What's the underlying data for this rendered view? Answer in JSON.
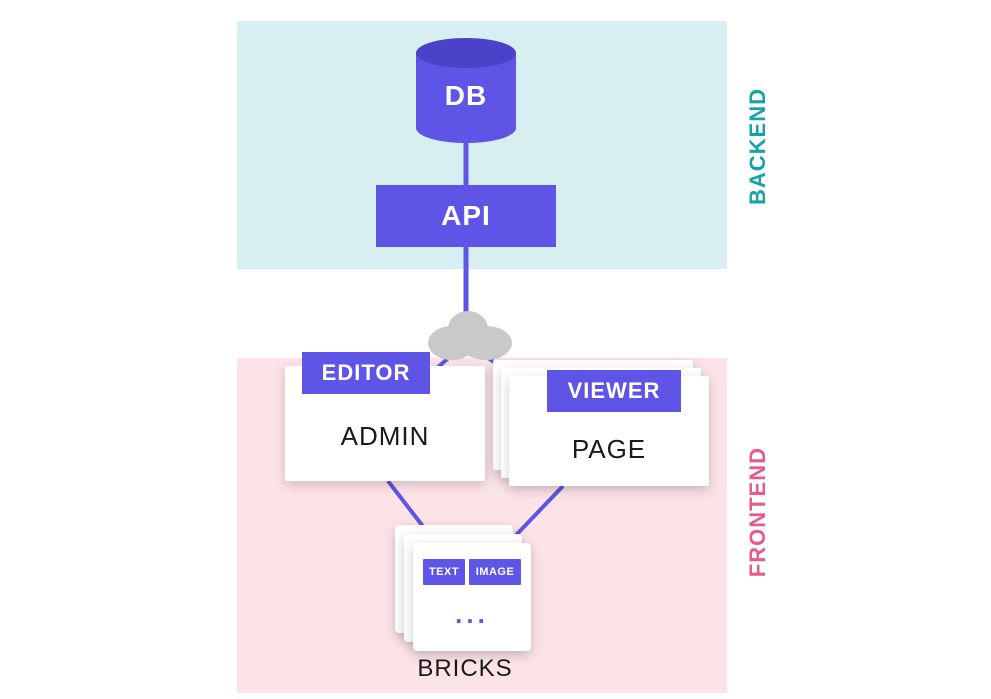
{
  "sections": {
    "backend_label": "BACKEND",
    "frontend_label": "FRONTEND"
  },
  "nodes": {
    "db": "DB",
    "api": "API",
    "editor_tag": "EDITOR",
    "admin": "ADMIN",
    "viewer_tag": "VIEWER",
    "page": "PAGE",
    "bricks_label": "BRICKS",
    "brick_chip_text": "TEXT",
    "brick_chip_image": "IMAGE",
    "brick_ellipsis": "..."
  },
  "colors": {
    "primary": "#5e55e6",
    "backend_bg": "#d7eff1",
    "frontend_bg": "#fce3e8",
    "backend_text": "#16a3a6",
    "frontend_text": "#e85a8a",
    "cloud": "#c9c9c9"
  }
}
